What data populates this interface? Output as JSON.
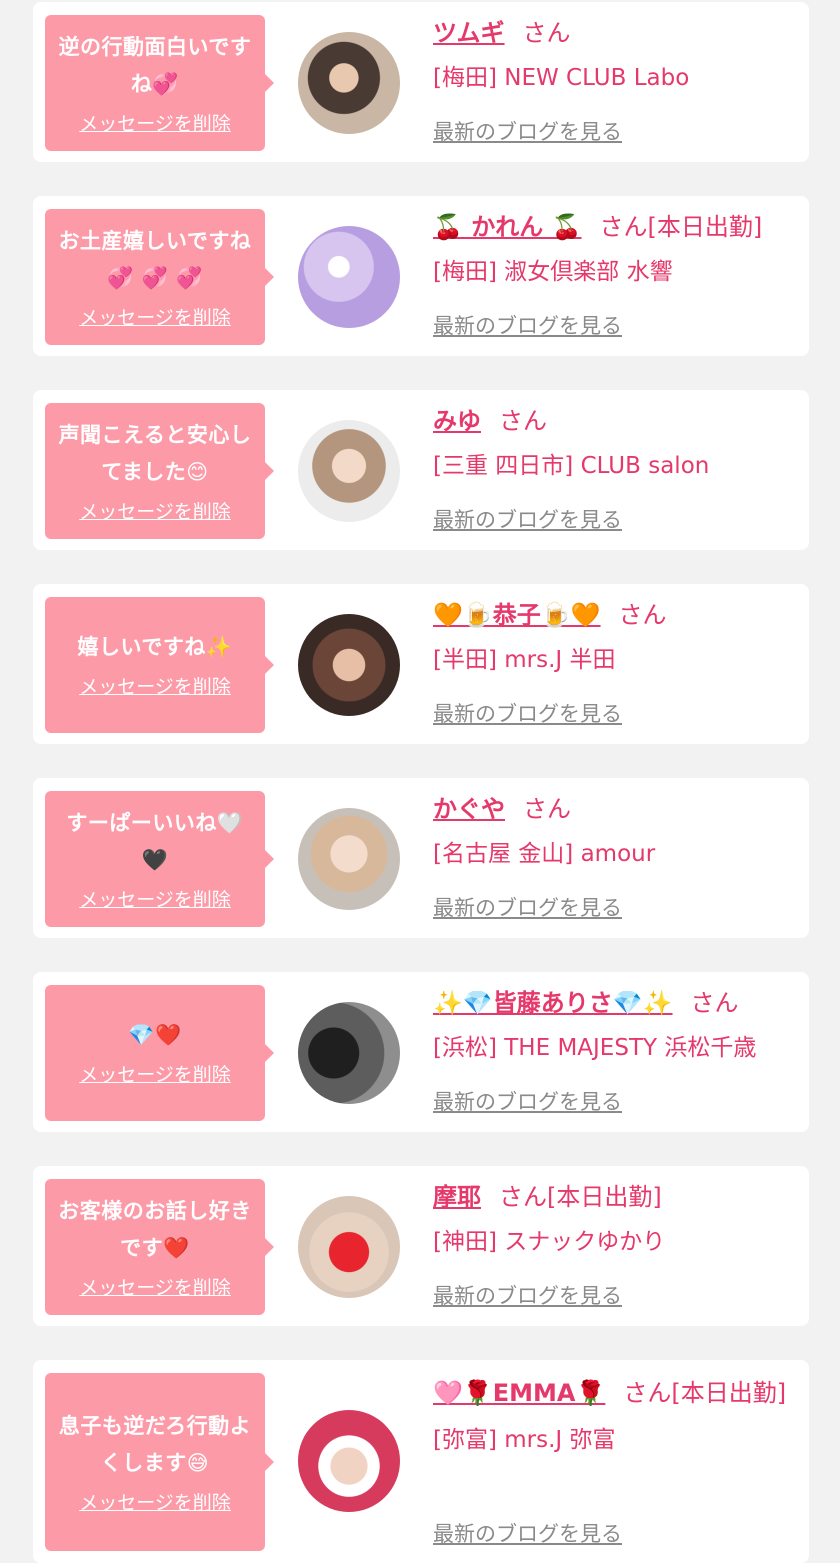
{
  "colors": {
    "background": "#f2f2f2",
    "card": "#ffffff",
    "bubble": "#fd9aa8",
    "accent": "#e5386b",
    "blog_link": "#8a8a8a"
  },
  "delete_label": "メッセージを削除",
  "blog_label": "最新のブログを見る",
  "entries": [
    {
      "message": "逆の行動面白いですね💞",
      "name": "ツムギ",
      "suffix": "さん",
      "shop": "[梅田] NEW CLUB Labo"
    },
    {
      "message": "お土産嬉しいですね💞 💞 💞",
      "name": "🍒 かれん 🍒",
      "suffix": "さん[本日出勤]",
      "shop": "[梅田] 淑女倶楽部 水響"
    },
    {
      "message": "声聞こえると安心してました😊",
      "name": "みゆ",
      "suffix": "さん",
      "shop": "[三重 四日市] CLUB salon"
    },
    {
      "message": "嬉しいですね✨",
      "name": "🧡🍺恭子🍺🧡",
      "suffix": "さん",
      "shop": "[半田] mrs.J 半田"
    },
    {
      "message": "すーぱーいいね🤍🖤",
      "name": "かぐや",
      "suffix": "さん",
      "shop": "[名古屋 金山] amour"
    },
    {
      "message": "💎❤️",
      "name": "✨💎皆藤ありさ💎✨",
      "suffix": "さん",
      "shop": "[浜松] THE MAJESTY 浜松千歳"
    },
    {
      "message": "お客様のお話し好きです❤️",
      "name": "摩耶",
      "suffix": "さん[本日出勤]",
      "shop": "[神田] スナックゆかり"
    },
    {
      "message": "息子も逆だろ行動よくします😅",
      "name": "🩷🌹EMMA🌹",
      "suffix": "さん[本日出勤]",
      "shop": "[弥富] mrs.J 弥富"
    }
  ]
}
